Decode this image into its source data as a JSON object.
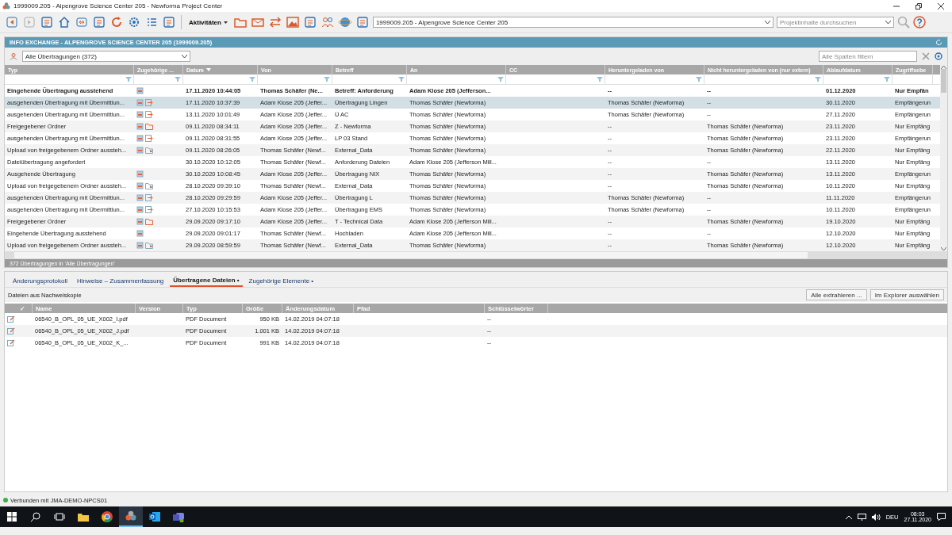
{
  "window": {
    "title": "1999009.205 - Alpengrove Science Center 205 - Newforma Project Center"
  },
  "toolbar": {
    "activities_label": "Aktivitäten",
    "project": "1999009.205 - Alpengrove Science Center 205",
    "search_placeholder": "Projektinhalte durchsuchen"
  },
  "panel": {
    "title": "INFO EXCHANGE - ALPENGROVE SCIENCE CENTER 205 (1999009.205)",
    "view": "Alle Übertragungen (372)",
    "filter_placeholder": "Alle Spalten filtern"
  },
  "table": {
    "columns": [
      {
        "label": "Typ",
        "sorted_descending": false
      },
      {
        "label": "Zugehörige ...",
        "sorted_descending": false
      },
      {
        "label": "Datum",
        "sorted_descending": true
      },
      {
        "label": "Von",
        "sorted_descending": false
      },
      {
        "label": "Betreff",
        "sorted_descending": false
      },
      {
        "label": "An",
        "sorted_descending": false
      },
      {
        "label": "CC",
        "sorted_descending": false
      },
      {
        "label": "Heruntergeladen von",
        "sorted_descending": false
      },
      {
        "label": "Nicht heruntergeladen von (nur extern)",
        "sorted_descending": false
      },
      {
        "label": "Ablaufdatum",
        "sorted_descending": false
      },
      {
        "label": "Zugriffsebe",
        "sorted_descending": false
      }
    ],
    "rows": [
      {
        "selected": false,
        "unread": true,
        "has_transmittal": true,
        "has_outgoing": false,
        "has_folder": false,
        "has_upload": false,
        "cells": [
          "Eingehende Übertragung ausstehend",
          "",
          "17.11.2020 10:44:05",
          "Thomas Schäfer (Ne...",
          "Betreff: Anforderung",
          "Adam Klose 205 (Jefferson...",
          "",
          "--",
          "--",
          "01.12.2020",
          "Nur Empfän"
        ]
      },
      {
        "selected": true,
        "unread": false,
        "has_transmittal": true,
        "has_outgoing": true,
        "has_folder": false,
        "has_upload": false,
        "cells": [
          "ausgehenden Übertragung mit Übermittlun...",
          "",
          "17.11.2020 10:37:39",
          "Adam Klose 205 (Jeffer...",
          "Übertragung Lingen",
          "Thomas Schäfer (Newforma)",
          "",
          "Thomas Schäfer (Newforma)",
          "--",
          "30.11.2020",
          "Empfängerun"
        ]
      },
      {
        "selected": false,
        "unread": false,
        "has_transmittal": true,
        "has_outgoing": true,
        "has_folder": false,
        "has_upload": false,
        "cells": [
          "ausgehenden Übertragung mit Übermittlun...",
          "",
          "13.11.2020 10:01:49",
          "Adam Klose 205 (Jeffer...",
          "Ü AC",
          "Thomas Schäfer (Newforma)",
          "",
          "Thomas Schäfer (Newforma)",
          "--",
          "27.11.2020",
          "Empfängerun"
        ]
      },
      {
        "selected": false,
        "unread": false,
        "has_transmittal": true,
        "has_outgoing": false,
        "has_folder": true,
        "has_upload": false,
        "cells": [
          "Freigegebener Ordner",
          "",
          "09.11.2020 08:34:11",
          "Adam Klose 205 (Jeffer...",
          "Z - Newforma",
          "Thomas Schäfer (Newforma)",
          "",
          "--",
          "Thomas Schäfer (Newforma)",
          "23.11.2020",
          "Nur Empfäng"
        ]
      },
      {
        "selected": false,
        "unread": false,
        "has_transmittal": true,
        "has_outgoing": true,
        "has_folder": false,
        "has_upload": false,
        "cells": [
          "ausgehenden Übertragung mit Übermittlun...",
          "",
          "09.11.2020 08:31:55",
          "Adam Klose 205 (Jeffer...",
          "LP 03 Stand",
          "Thomas Schäfer (Newforma)",
          "",
          "--",
          "Thomas Schäfer (Newforma)",
          "23.11.2020",
          "Empfängerun"
        ]
      },
      {
        "selected": false,
        "unread": false,
        "has_transmittal": true,
        "has_outgoing": false,
        "has_folder": false,
        "has_upload": true,
        "cells": [
          "Upload von freigegebenem Ordner aussteh...",
          "",
          "09.11.2020 08:26:05",
          "Thomas Schäfer (Newf...",
          "External_Data",
          "Thomas Schäfer (Newforma)",
          "",
          "--",
          "Thomas Schäfer (Newforma)",
          "22.11.2020",
          "Nur Empfäng"
        ]
      },
      {
        "selected": false,
        "unread": false,
        "has_transmittal": false,
        "has_outgoing": false,
        "has_folder": false,
        "has_upload": false,
        "cells": [
          "Dateiübertragung angefordert",
          "",
          "30.10.2020 10:12:05",
          "Thomas Schäfer (Newf...",
          "Anforderung Dateien",
          "Adam Klose 205 (Jefferson Mill...",
          "",
          "--",
          "--",
          "13.11.2020",
          "Nur Empfäng"
        ]
      },
      {
        "selected": false,
        "unread": false,
        "has_transmittal": true,
        "has_outgoing": false,
        "has_folder": false,
        "has_upload": false,
        "cells": [
          "Ausgehende Übertragung",
          "",
          "30.10.2020 10:08:45",
          "Adam Klose 205 (Jeffer...",
          "Übertragung NIX",
          "Thomas Schäfer (Newforma)",
          "",
          "--",
          "Thomas Schäfer (Newforma)",
          "13.11.2020",
          "Empfängerun"
        ]
      },
      {
        "selected": false,
        "unread": false,
        "has_transmittal": true,
        "has_outgoing": false,
        "has_folder": false,
        "has_upload": true,
        "cells": [
          "Upload von freigegebenem Ordner aussteh...",
          "",
          "28.10.2020 09:39:10",
          "Thomas Schäfer (Newf...",
          "External_Data",
          "Thomas Schäfer (Newforma)",
          "",
          "--",
          "Thomas Schäfer (Newforma)",
          "10.11.2020",
          "Nur Empfäng"
        ]
      },
      {
        "selected": false,
        "unread": false,
        "has_transmittal": true,
        "has_outgoing": true,
        "has_folder": false,
        "has_upload": false,
        "cells": [
          "ausgehenden Übertragung mit Übermittlun...",
          "",
          "28.10.2020 09:29:59",
          "Adam Klose 205 (Jeffer...",
          "Übertragung L",
          "Thomas Schäfer (Newforma)",
          "",
          "Thomas Schäfer (Newforma)",
          "--",
          "11.11.2020",
          "Empfängerun"
        ]
      },
      {
        "selected": false,
        "unread": false,
        "has_transmittal": true,
        "has_outgoing": true,
        "has_folder": false,
        "has_upload": false,
        "cells": [
          "ausgehenden Übertragung mit Übermittlun...",
          "",
          "27.10.2020 10:15:53",
          "Adam Klose 205 (Jeffer...",
          "Übertragung EMS",
          "Thomas Schäfer (Newforma)",
          "",
          "Thomas Schäfer (Newforma)",
          "--",
          "10.11.2020",
          "Empfängerun"
        ]
      },
      {
        "selected": false,
        "unread": false,
        "has_transmittal": true,
        "has_outgoing": false,
        "has_folder": true,
        "has_upload": false,
        "cells": [
          "Freigegebener Ordner",
          "",
          "29.09.2020 09:17:10",
          "Adam Klose 205 (Jeffer...",
          "T - Technical Data",
          "Adam Klose 205 (Jefferson Mill...",
          "",
          "--",
          "Thomas Schäfer (Newforma)",
          "19.10.2020",
          "Nur Empfäng"
        ]
      },
      {
        "selected": false,
        "unread": false,
        "has_transmittal": true,
        "has_outgoing": false,
        "has_folder": false,
        "has_upload": false,
        "cells": [
          "Eingehende Übertragung ausstehend",
          "",
          "29.09.2020 09:01:17",
          "Thomas Schäfer (Newf...",
          "Hochladen",
          "Adam Klose 205 (Jefferson Mill...",
          "",
          "--",
          "--",
          "12.10.2020",
          "Nur Empfäng"
        ]
      },
      {
        "selected": false,
        "unread": false,
        "has_transmittal": true,
        "has_outgoing": false,
        "has_folder": false,
        "has_upload": true,
        "cells": [
          "Upload von freigegebenem Ordner aussteh...",
          "",
          "29.09.2020 08:59:59",
          "Thomas Schäfer (Newf...",
          "External_Data",
          "Thomas Schäfer (Newforma)",
          "",
          "--",
          "Thomas Schäfer (Newforma)",
          "12.10.2020",
          "Nur Empfäng"
        ]
      }
    ],
    "count_text": "372 Übertragungen in 'Alle Übertragungen'"
  },
  "detail_tabs": [
    {
      "label": "Änderungsprotokoll",
      "selected": false
    },
    {
      "label": "Hinweise – Zusammenfassung",
      "selected": false
    },
    {
      "label": "Übertragene Dateien •",
      "selected": true
    },
    {
      "label": "Zugehörige Elemente •",
      "selected": false
    }
  ],
  "files": {
    "caption": "Dateien aus Nachweiskopie",
    "buttons": [
      "Alle extrahieren ...",
      "Im Explorer auswählen"
    ],
    "columns": [
      "✓",
      "Name",
      "Version",
      "Typ",
      "Größe",
      "Änderungsdatum",
      "Pfad",
      "Schlüsselwörter"
    ],
    "rows": [
      {
        "cells": [
          "",
          "06540_B_OPL_05_UE_X002_I.pdf",
          "",
          "PDF Document",
          "950 KB",
          "14.02.2019 04:07:18",
          "",
          "--"
        ]
      },
      {
        "cells": [
          "",
          "06540_B_OPL_05_UE_X002_J.pdf",
          "",
          "PDF Document",
          "1.001 KB",
          "14.02.2019 04:07:18",
          "",
          "--"
        ]
      },
      {
        "cells": [
          "",
          "06540_B_OPL_05_UE_X002_K_...",
          "",
          "PDF Document",
          "991 KB",
          "14.02.2019 04:07:18",
          "",
          "--"
        ]
      }
    ]
  },
  "status_bar": {
    "connection": "Verbunden mit JMA-DEMO-NPCS01",
    "online": true
  },
  "taskbar": {
    "language": "DEU",
    "time": "08:03",
    "date": "27.11.2020"
  }
}
